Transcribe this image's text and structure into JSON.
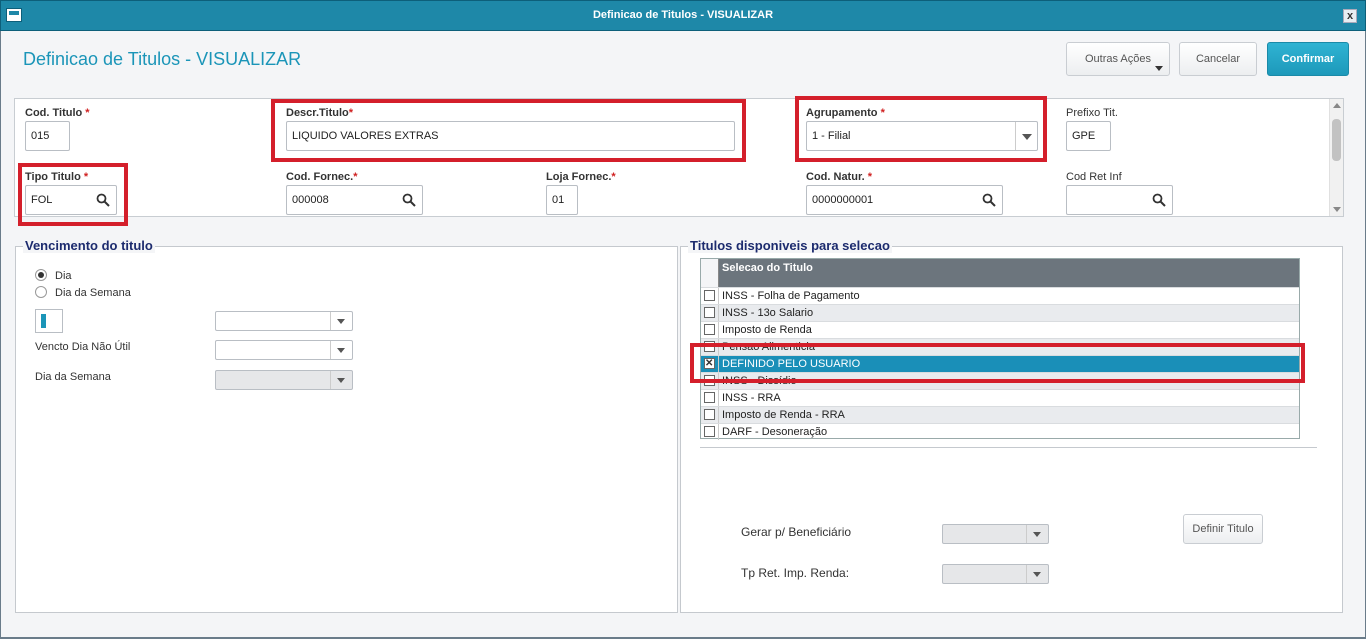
{
  "window": {
    "title": "Definicao de Titulos - VISUALIZAR",
    "close_label": "x"
  },
  "page": {
    "title": "Definicao de Titulos - VISUALIZAR"
  },
  "toolbar": {
    "other_actions_label": "Outras Ações",
    "cancel_label": "Cancelar",
    "confirm_label": "Confirmar"
  },
  "form": {
    "cod_titulo": {
      "label": "Cod. Titulo",
      "required": "*",
      "value": "015"
    },
    "descr_titulo": {
      "label": "Descr.Titulo",
      "required": "*",
      "value": "LIQUIDO VALORES EXTRAS"
    },
    "agrupamento": {
      "label": "Agrupamento",
      "required": "*",
      "value": "1 - Filial"
    },
    "prefixo_tit": {
      "label": "Prefixo Tit.",
      "value": "GPE"
    },
    "tipo_titulo": {
      "label": "Tipo Titulo",
      "required": "*",
      "value": "FOL"
    },
    "cod_fornec": {
      "label": "Cod. Fornec.",
      "required": "*",
      "value": "000008"
    },
    "loja_fornec": {
      "label": "Loja Fornec.",
      "required": "*",
      "value": "01"
    },
    "cod_natur": {
      "label": "Cod. Natur.",
      "required": "*",
      "value": "0000000001"
    },
    "cod_ret_inf": {
      "label": "Cod Ret Inf",
      "value": ""
    }
  },
  "vencimento": {
    "title": "Vencimento do titulo",
    "radio_dia": "Dia",
    "radio_dia_semana": "Dia da Semana",
    "vencto_label": "Vencto Dia Não Útil",
    "dia_semana_label": "Dia da Semana"
  },
  "titulos": {
    "title": "Titulos disponiveis para selecao",
    "column_header": "Selecao do Titulo",
    "rows": [
      {
        "label": "INSS - Folha de Pagamento",
        "checked": false
      },
      {
        "label": "INSS - 13o Salario",
        "checked": false
      },
      {
        "label": "Imposto de Renda",
        "checked": false
      },
      {
        "label": "Pensao Alimenticia",
        "checked": false
      },
      {
        "label": "DEFINIDO PELO USUARIO",
        "checked": true
      },
      {
        "label": "INSS - Dissídio",
        "checked": false
      },
      {
        "label": "INSS - RRA",
        "checked": false
      },
      {
        "label": "Imposto de Renda - RRA",
        "checked": false
      },
      {
        "label": "DARF - Desoneração",
        "checked": false
      }
    ],
    "gerar_label": "Gerar p/ Beneficiário",
    "tp_ret_label": "Tp Ret. Imp. Renda:",
    "definir_label": "Definir Titulo"
  },
  "colors": {
    "accent": "#1b95b8",
    "highlight": "#d41f2b",
    "selected_row": "#1a8fb8"
  }
}
